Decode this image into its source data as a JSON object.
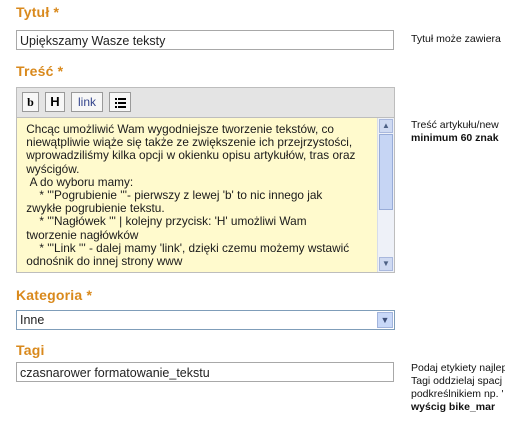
{
  "title_field": {
    "label": "Tytuł *",
    "value": "Upiększamy Wasze teksty",
    "help": "Tytuł może zawiera"
  },
  "content_field": {
    "label": "Treść *",
    "toolbar": {
      "bold": "b",
      "heading": "H",
      "link": "link"
    },
    "text": " Chcąc umożliwić Wam wygodniejsze tworzenie tekstów, co\n niewątpliwie wiąże się także ze zwiększenie ich przejrzystości,\n wprowadziliśmy kilka opcji w okienku opisu artykułów, tras oraz\n wyścigów.\n  A do wyboru mamy:\n     * '''Pogrubienie '''- pierwszy z lewej 'b' to nic innego jak\n zwykłe pogrubienie tekstu.\n     * '''Nagłówek ''' | kolejny przycisk: 'H' umożliwi Wam\n tworzenie nagłówków\n     * '''Link ''' - dalej mamy 'link', dzięki czemu możemy wstawić\n odnośnik do innej strony www",
    "help_line1": "Treść artykułu/new",
    "help_line2": "minimum 60 znak"
  },
  "category_field": {
    "label": "Kategoria *",
    "selected": "Inne"
  },
  "tags_field": {
    "label": "Tagi",
    "value": "czasnarower formatowanie_tekstu",
    "help_line1": "Podaj etykiety najlep",
    "help_line2": "Tagi oddzielaj spacj",
    "help_line3": "podkreślnikiem np. '",
    "help_line4": "wyścig bike_mar"
  }
}
